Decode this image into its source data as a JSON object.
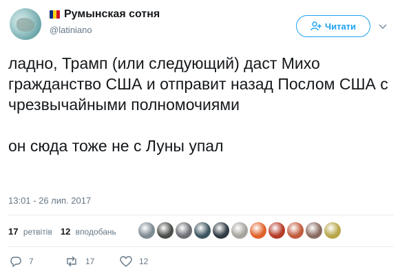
{
  "profile": {
    "display_name": "Румынская сотня",
    "handle": "@latiniano",
    "flag_colors": [
      "#002b7f",
      "#fcd116",
      "#ce1126"
    ]
  },
  "follow_button": {
    "label": "Читати",
    "icon": "add-user-icon"
  },
  "tweet": {
    "text": "ладно, Трамп (или следующий) даст Михо гражданство США и отправит назад Послом США с чрезвычайными полномочиями\n\nон сюда тоже не с Луны упал",
    "timestamp": "13:01 - 26 лип. 2017"
  },
  "stats": {
    "retweets_count": "17",
    "retweets_label": "ретвітів",
    "likes_count": "12",
    "likes_label": "вподобань"
  },
  "likers": [
    "#7d8a92",
    "#4a4e49",
    "#6b6e73",
    "#3d5560",
    "#2f3a44",
    "#a6a39e",
    "#e0622a",
    "#b53a27",
    "#c25a3c",
    "#8a6a60",
    "#b7a648"
  ],
  "actions": {
    "reply": {
      "icon": "reply-icon",
      "count": "7"
    },
    "retweet": {
      "icon": "retweet-icon",
      "count": "17"
    },
    "like": {
      "icon": "heart-icon",
      "count": "12"
    }
  },
  "colors": {
    "accent": "#1da1f2",
    "text": "#14171a",
    "muted": "#657786"
  }
}
